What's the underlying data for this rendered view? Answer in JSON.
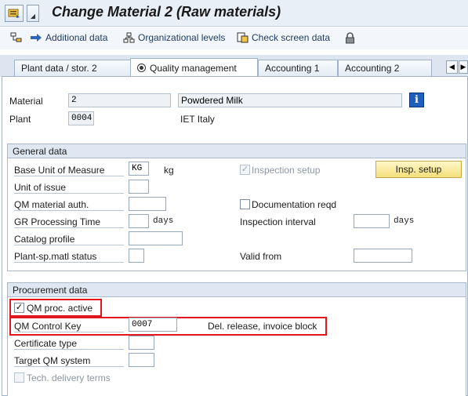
{
  "window": {
    "title": "Change Material 2 (Raw materials)"
  },
  "toolbar": {
    "additional_data": "Additional data",
    "organizational_levels": "Organizational levels",
    "check_screen_data": "Check screen data"
  },
  "tabs": [
    {
      "label": "Plant data / stor. 2",
      "active": false
    },
    {
      "label": "Quality management",
      "active": true
    },
    {
      "label": "Accounting 1",
      "active": false
    },
    {
      "label": "Accounting 2",
      "active": false
    }
  ],
  "header": {
    "material_label": "Material",
    "material_value": "2",
    "material_description": "Powdered Milk",
    "plant_label": "Plant",
    "plant_value": "0004",
    "plant_description": "IET Italy"
  },
  "general_data": {
    "title": "General data",
    "base_uom_label": "Base Unit of Measure",
    "base_uom_value": "KG",
    "base_uom_text": "kg",
    "unit_of_issue_label": "Unit of issue",
    "qm_material_auth_label": "QM material auth.",
    "gr_processing_time_label": "GR Processing Time",
    "gr_days": "days",
    "catalog_profile_label": "Catalog profile",
    "plant_sp_matl_status_label": "Plant-sp.matl status",
    "inspection_setup_label": "Inspection setup",
    "insp_setup_button": "Insp. setup",
    "documentation_reqd_label": "Documentation reqd",
    "inspection_interval_label": "Inspection interval",
    "inspection_days": "days",
    "valid_from_label": "Valid from"
  },
  "procurement_data": {
    "title": "Procurement data",
    "qm_proc_active_label": "QM proc. active",
    "qm_control_key_label": "QM Control Key",
    "qm_control_key_value": "0007",
    "qm_control_key_text": "Del. release, invoice block",
    "certificate_type_label": "Certificate type",
    "target_qm_system_label": "Target QM system",
    "tech_delivery_terms_label": "Tech. delivery terms"
  },
  "colors": {
    "highlight": "#e3151f",
    "accent": "#1f3c66",
    "button_yellow": "#f4df7c"
  }
}
